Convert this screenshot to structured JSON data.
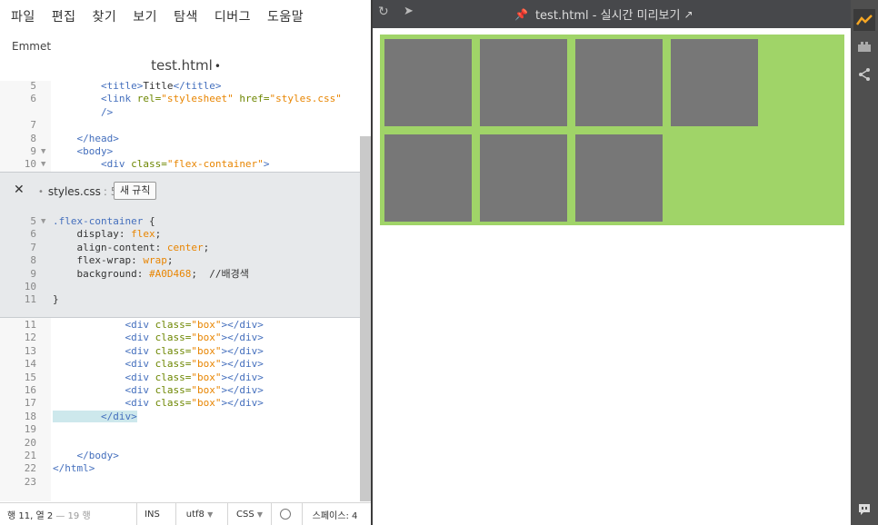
{
  "menu": [
    "파일",
    "편집",
    "찾기",
    "보기",
    "탐색",
    "디버그",
    "도움말"
  ],
  "emmet_label": "Emmet",
  "file_title": "test.html",
  "file_dirty_dot": "•",
  "editor_top": {
    "lines": [
      {
        "n": "5",
        "fold": "",
        "segs": [
          {
            "c": "t-tag",
            "t": "        <title>"
          },
          {
            "c": "t-plain",
            "t": "Title"
          },
          {
            "c": "t-tag",
            "t": "</title>"
          }
        ]
      },
      {
        "n": "6",
        "fold": "",
        "segs": [
          {
            "c": "t-tag",
            "t": "        <link "
          },
          {
            "c": "t-attr",
            "t": "rel="
          },
          {
            "c": "t-str",
            "t": "\"stylesheet\""
          },
          {
            "c": "t-attr",
            "t": " href="
          },
          {
            "c": "t-str",
            "t": "\"styles.css\""
          }
        ]
      },
      {
        "n": "",
        "fold": "",
        "segs": [
          {
            "c": "t-tag",
            "t": "        />"
          }
        ]
      },
      {
        "n": "7",
        "fold": "",
        "segs": []
      },
      {
        "n": "8",
        "fold": "",
        "segs": [
          {
            "c": "t-tag",
            "t": "    </head>"
          }
        ]
      },
      {
        "n": "9",
        "fold": "▼",
        "segs": [
          {
            "c": "t-tag",
            "t": "    <body>"
          }
        ]
      },
      {
        "n": "10",
        "fold": "▼",
        "segs": [
          {
            "c": "t-tag",
            "t": "        <div "
          },
          {
            "c": "t-attr",
            "t": "class="
          },
          {
            "c": "t-str",
            "t": "\"flex-container\""
          },
          {
            "c": "t-tag",
            "t": ">"
          }
        ]
      }
    ]
  },
  "inline_editor": {
    "file": "styles.css",
    "line_ref": ": 5",
    "new_rule_label": "새 규칙",
    "lines": [
      {
        "n": "5",
        "fold": "▼",
        "segs": [
          {
            "c": "t-sel",
            "t": ".flex-container"
          },
          {
            "c": "t-plain",
            "t": " {"
          }
        ]
      },
      {
        "n": "6",
        "fold": "",
        "segs": [
          {
            "c": "t-prop",
            "t": "    display: "
          },
          {
            "c": "t-val",
            "t": "flex"
          },
          {
            "c": "t-plain",
            "t": ";"
          }
        ]
      },
      {
        "n": "7",
        "fold": "",
        "segs": [
          {
            "c": "t-prop",
            "t": "    align-content: "
          },
          {
            "c": "t-val",
            "t": "center"
          },
          {
            "c": "t-plain",
            "t": ";"
          }
        ]
      },
      {
        "n": "8",
        "fold": "",
        "segs": [
          {
            "c": "t-prop",
            "t": "    flex-wrap: "
          },
          {
            "c": "t-val",
            "t": "wrap"
          },
          {
            "c": "t-plain",
            "t": ";"
          }
        ]
      },
      {
        "n": "9",
        "fold": "",
        "segs": [
          {
            "c": "t-prop",
            "t": "    background: "
          },
          {
            "c": "t-val",
            "t": "#A0D468"
          },
          {
            "c": "t-plain",
            "t": ";  "
          },
          {
            "c": "t-com",
            "t": "//배경색"
          }
        ]
      },
      {
        "n": "10",
        "fold": "",
        "segs": []
      },
      {
        "n": "11",
        "fold": "",
        "segs": [
          {
            "c": "t-plain",
            "t": "}"
          }
        ]
      }
    ]
  },
  "editor_bottom": {
    "lines": [
      {
        "n": "11",
        "segs": [
          {
            "c": "t-tag",
            "t": "            <div "
          },
          {
            "c": "t-attr",
            "t": "class="
          },
          {
            "c": "t-str",
            "t": "\"box\""
          },
          {
            "c": "t-tag",
            "t": "></div>"
          }
        ]
      },
      {
        "n": "12",
        "segs": [
          {
            "c": "t-tag",
            "t": "            <div "
          },
          {
            "c": "t-attr",
            "t": "class="
          },
          {
            "c": "t-str",
            "t": "\"box\""
          },
          {
            "c": "t-tag",
            "t": "></div>"
          }
        ]
      },
      {
        "n": "13",
        "segs": [
          {
            "c": "t-tag",
            "t": "            <div "
          },
          {
            "c": "t-attr",
            "t": "class="
          },
          {
            "c": "t-str",
            "t": "\"box\""
          },
          {
            "c": "t-tag",
            "t": "></div>"
          }
        ]
      },
      {
        "n": "14",
        "segs": [
          {
            "c": "t-tag",
            "t": "            <div "
          },
          {
            "c": "t-attr",
            "t": "class="
          },
          {
            "c": "t-str",
            "t": "\"box\""
          },
          {
            "c": "t-tag",
            "t": "></div>"
          }
        ]
      },
      {
        "n": "15",
        "segs": [
          {
            "c": "t-tag",
            "t": "            <div "
          },
          {
            "c": "t-attr",
            "t": "class="
          },
          {
            "c": "t-str",
            "t": "\"box\""
          },
          {
            "c": "t-tag",
            "t": "></div>"
          }
        ]
      },
      {
        "n": "16",
        "segs": [
          {
            "c": "t-tag",
            "t": "            <div "
          },
          {
            "c": "t-attr",
            "t": "class="
          },
          {
            "c": "t-str",
            "t": "\"box\""
          },
          {
            "c": "t-tag",
            "t": "></div>"
          }
        ]
      },
      {
        "n": "17",
        "segs": [
          {
            "c": "t-tag",
            "t": "            <div "
          },
          {
            "c": "t-attr",
            "t": "class="
          },
          {
            "c": "t-str",
            "t": "\"box\""
          },
          {
            "c": "t-tag",
            "t": "></div>"
          }
        ]
      },
      {
        "n": "18",
        "segs": [
          {
            "c": "t-tag hl",
            "t": "        </div>"
          }
        ]
      },
      {
        "n": "19",
        "segs": []
      },
      {
        "n": "20",
        "segs": []
      },
      {
        "n": "21",
        "segs": [
          {
            "c": "t-tag",
            "t": "    </body>"
          }
        ]
      },
      {
        "n": "22",
        "segs": [
          {
            "c": "t-tag",
            "t": "</html>"
          }
        ]
      },
      {
        "n": "23",
        "segs": []
      }
    ]
  },
  "status": {
    "position": "행 11, 열 2",
    "line_count": " — 19 행",
    "ins": "INS",
    "encoding": "utf8",
    "language": "CSS",
    "dropdown_arrow": "▼",
    "indent": "스페이스: 4"
  },
  "preview": {
    "title": "test.html - 실시간 미리보기",
    "reload_icon": "↻",
    "nav_icon": "➤",
    "pin_icon": "📌",
    "external_icon": "↗",
    "container_color": "#A0D468",
    "box_color": "#777777",
    "box_count": 7
  },
  "toolbar_icons": [
    "live-preview-icon",
    "extensions-icon",
    "share-icon",
    "feedback-icon"
  ]
}
